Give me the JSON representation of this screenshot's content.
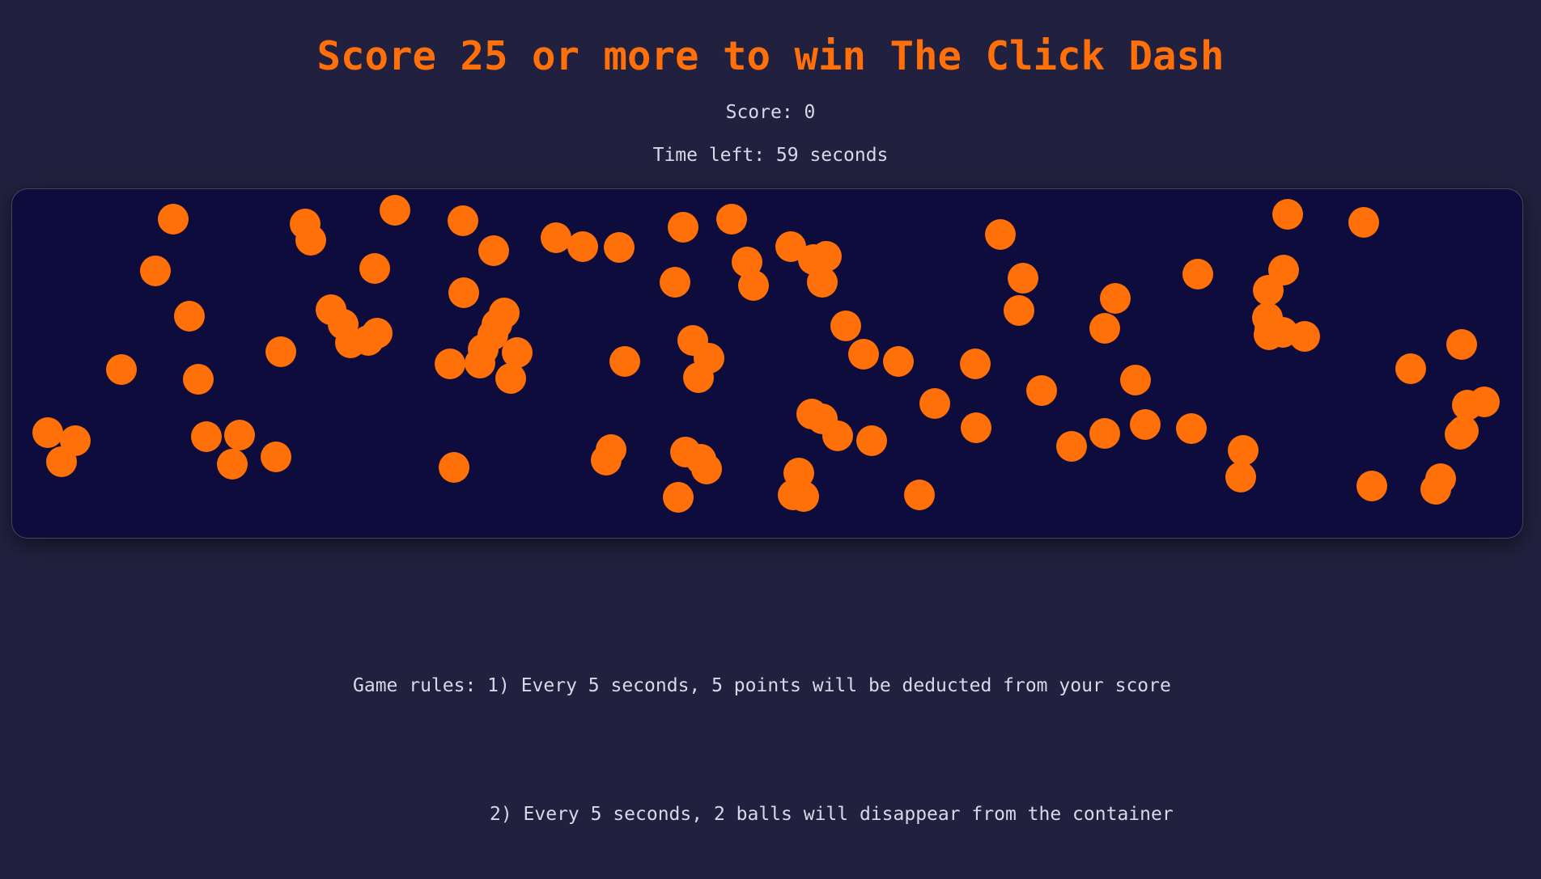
{
  "header": {
    "title": "Score 25 or more to win The Click Dash",
    "score_text": "Score: 0",
    "time_text": "Time left: 59 seconds"
  },
  "game": {
    "ball_color": "#ff7008",
    "container_bg": "#0d0c3c",
    "accent_color": "#ff700b",
    "ball_count": 100
  },
  "rules": {
    "line1": "Game rules: 1) Every 5 seconds, 5 points will be deducted from your score",
    "line2": "2) Every 5 seconds, 2 balls will disappear from the container"
  }
}
